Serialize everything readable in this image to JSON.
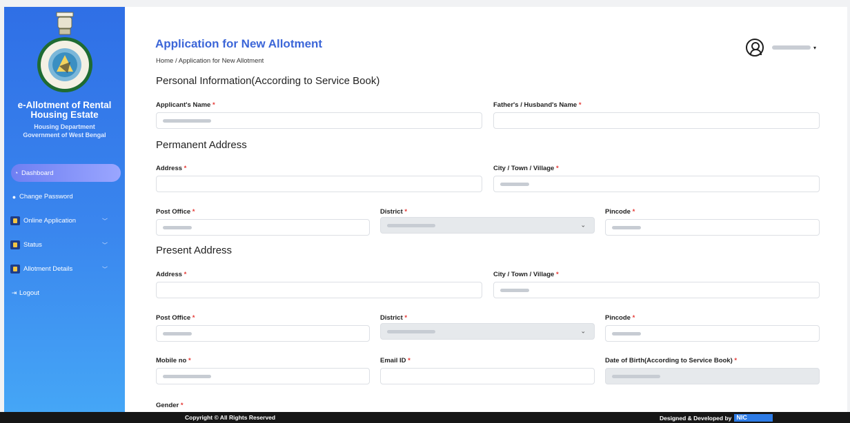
{
  "sidebar": {
    "title": "e-Allotment of Rental Housing Estate",
    "department": "Housing Department",
    "government": "Government of West Bengal",
    "items": [
      {
        "label": "Dashboard",
        "icon": "dashboard-icon"
      },
      {
        "label": "Change Password",
        "icon": "key-icon"
      },
      {
        "label": "Online Application",
        "icon": "document-icon"
      },
      {
        "label": "Status",
        "icon": "document-icon"
      },
      {
        "label": "Allotment Details",
        "icon": "document-icon"
      },
      {
        "label": "Logout",
        "icon": "logout-icon"
      }
    ]
  },
  "header": {
    "title": "Application for New Allotment",
    "breadcrumb": "Home / Application for New Allotment"
  },
  "sections": {
    "personal": "Personal Information(According to Service Book)",
    "permanent": "Permanent Address",
    "present": "Present Address"
  },
  "labels": {
    "applicant_name": "Applicant's Name",
    "father_name": "Father's / Husband's Name",
    "address": "Address",
    "city": "City / Town / Village",
    "post_office": "Post Office",
    "district": "District",
    "pincode": "Pincode",
    "mobile": "Mobile no",
    "email": "Email ID",
    "dob": "Date of Birth(According to Service Book)",
    "gender": "Gender",
    "required_mark": "*"
  },
  "footer": {
    "copyright": "Copyright © All Rights Reserved",
    "credit": "Designed & Developed by",
    "logo": "NIC"
  },
  "colors": {
    "title": "#3c66d8",
    "required": "#e53935",
    "sidebar_top": "#2f6fe6",
    "sidebar_bottom": "#45a6f6"
  }
}
